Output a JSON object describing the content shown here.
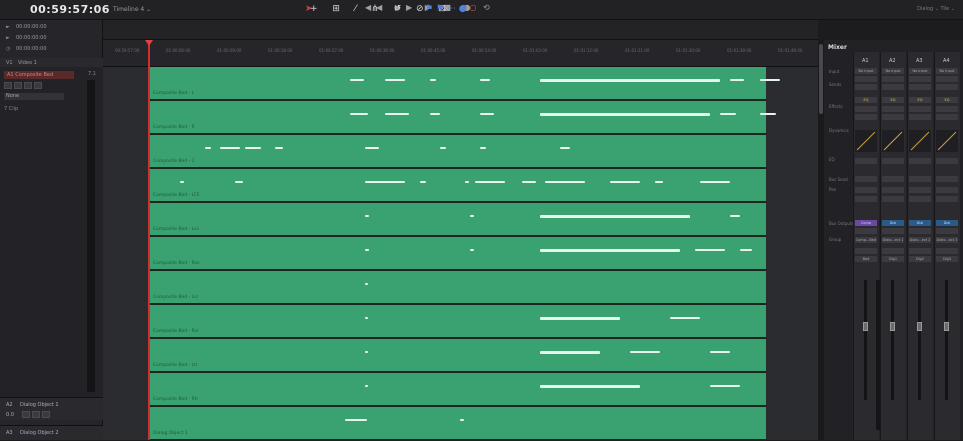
{
  "topbar": {
    "timecode": "00:59:57:06",
    "timeline_name": "Timeline 4 ⌄",
    "transport_icons": "◀◀ ▶▶ ▶ ■ ● ⟲",
    "dialog_label": "Dialog ⌄  Tile ⌄"
  },
  "left_panel": {
    "tc_rows": [
      {
        "marker": "►",
        "value": "00:00:00:00"
      },
      {
        "marker": "►",
        "value": "00:00:00:00"
      },
      {
        "marker": "◷",
        "value": "00:00:00:00"
      }
    ],
    "v1_label": "V1",
    "v1_name": "Video 1",
    "a1_label": "A1",
    "a1_name": "Composite Bed",
    "a1_channels": "7.1",
    "a1_buttons": [
      "0.0",
      "R",
      "S",
      "M"
    ],
    "dropdown": "None",
    "clip_label": "7 Clip",
    "a2_label": "A2",
    "a2_name": "Dialog Object 1",
    "a2_value": "0.0",
    "a2_buttons": [
      "R",
      "S",
      "M"
    ],
    "a3_label": "A3",
    "a3_name": "Dialog Object 2"
  },
  "ruler": {
    "ticks": [
      "00:59:57:06",
      "01:00:06:00",
      "01:00:09:00",
      "01:00:18:00",
      "01:00:27:00",
      "01:00:36:00",
      "01:00:45:00",
      "01:00:54:00",
      "01:01:03:00",
      "01:01:12:00",
      "01:01:21:00",
      "01:01:30:00",
      "01:01:39:00",
      "01:01:48:00"
    ]
  },
  "lanes": [
    {
      "label": "Composite Bed - L"
    },
    {
      "label": "Composite Bed - R"
    },
    {
      "label": "Composite Bed - C"
    },
    {
      "label": "Composite Bed - LFE"
    },
    {
      "label": "Composite Bed - Lss"
    },
    {
      "label": "Composite Bed - Rss"
    },
    {
      "label": "Composite Bed - Lsr"
    },
    {
      "label": "Composite Bed - Rsr"
    },
    {
      "label": "Composite Bed - Ltr"
    },
    {
      "label": "Composite Bed - Rtr"
    },
    {
      "label": "Dialog Object 1"
    }
  ],
  "mixer": {
    "title": "Mixer",
    "row_labels": [
      "Input",
      "Sends",
      "Effects",
      "EQ",
      "Dynamics",
      "Bus Send",
      "Pan",
      "Bus Outputs",
      "Group"
    ],
    "columns": [
      {
        "name": "A1",
        "input": "No Input",
        "eq": "EQ",
        "bus": "Comp",
        "group": "Comp...Bed",
        "label": "Bed"
      },
      {
        "name": "A2",
        "input": "No Input",
        "eq": "EQ",
        "bus": "Dial",
        "group": "Dialo...ect 1",
        "label": "Dlg1"
      },
      {
        "name": "A3",
        "input": "No Input",
        "eq": "EQ",
        "bus": "Dial",
        "group": "Dialo...ect 2",
        "label": "Dlg2"
      },
      {
        "name": "A4",
        "input": "No Input",
        "eq": "EQ",
        "bus": "Dial",
        "group": "Dialo...ect 3",
        "label": "Dlg3"
      }
    ]
  },
  "colors": {
    "clip_green": "#3aa271",
    "playhead": "#d03030"
  }
}
